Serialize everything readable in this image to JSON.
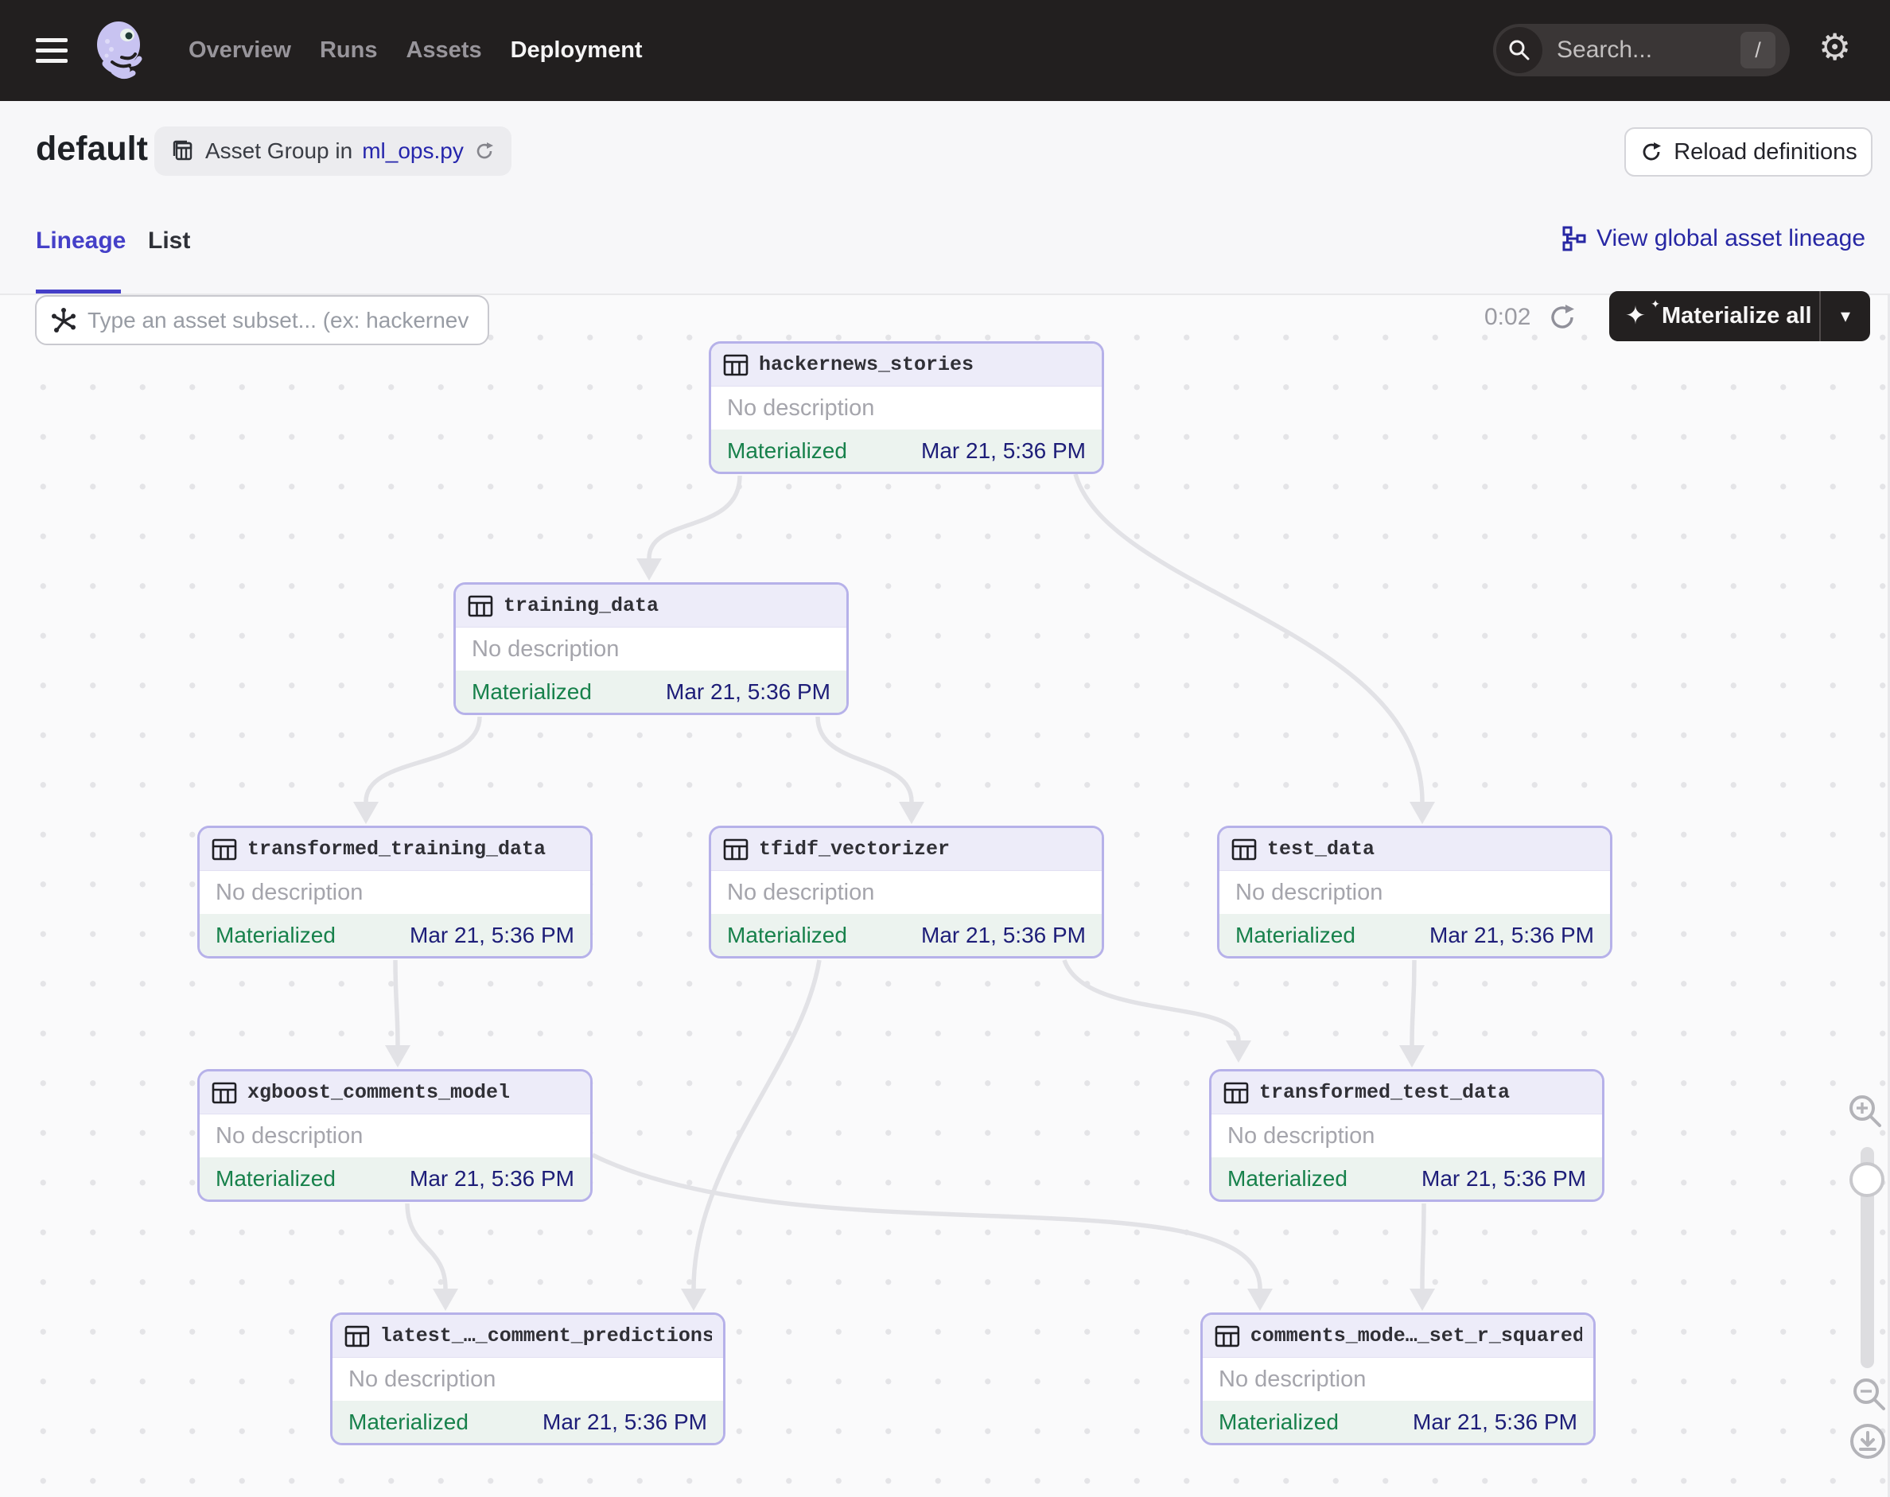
{
  "nav": {
    "items": [
      {
        "label": "Overview",
        "active": false
      },
      {
        "label": "Runs",
        "active": false
      },
      {
        "label": "Assets",
        "active": false
      },
      {
        "label": "Deployment",
        "active": true
      }
    ],
    "search": {
      "placeholder": "Search...",
      "shortcut": "/"
    }
  },
  "header": {
    "title": "default",
    "badge": {
      "prefix": "Asset Group in",
      "link": "ml_ops.py"
    },
    "reload_label": "Reload definitions"
  },
  "tabs": {
    "lineage": "Lineage",
    "list": "List",
    "active": "Lineage"
  },
  "global_lineage_label": "View global asset lineage",
  "toolbar": {
    "subset_placeholder": "Type an asset subset... (ex: hackernev",
    "timer": "0:02",
    "materialize_label": "Materialize all"
  },
  "graph": {
    "nodes": [
      {
        "id": "hn",
        "name": "hackernews_stories",
        "description": "No description",
        "status": "Materialized",
        "date": "Mar 21, 5:36 PM"
      },
      {
        "id": "tr",
        "name": "training_data",
        "description": "No description",
        "status": "Materialized",
        "date": "Mar 21, 5:36 PM"
      },
      {
        "id": "ttr",
        "name": "transformed_training_data",
        "description": "No description",
        "status": "Materialized",
        "date": "Mar 21, 5:36 PM"
      },
      {
        "id": "tf",
        "name": "tfidf_vectorizer",
        "description": "No description",
        "status": "Materialized",
        "date": "Mar 21, 5:36 PM"
      },
      {
        "id": "te",
        "name": "test_data",
        "description": "No description",
        "status": "Materialized",
        "date": "Mar 21, 5:36 PM"
      },
      {
        "id": "xg",
        "name": "xgboost_comments_model",
        "description": "No description",
        "status": "Materialized",
        "date": "Mar 21, 5:36 PM"
      },
      {
        "id": "tte",
        "name": "transformed_test_data",
        "description": "No description",
        "status": "Materialized",
        "date": "Mar 21, 5:36 PM"
      },
      {
        "id": "lp",
        "name": "latest_…_comment_predictions",
        "description": "No description",
        "status": "Materialized",
        "date": "Mar 21, 5:36 PM"
      },
      {
        "id": "rs",
        "name": "comments_mode…_set_r_squared",
        "description": "No description",
        "status": "Materialized",
        "date": "Mar 21, 5:36 PM"
      }
    ],
    "edges": [
      {
        "from": "hn",
        "to": "tr"
      },
      {
        "from": "hn",
        "to": "te"
      },
      {
        "from": "tr",
        "to": "ttr"
      },
      {
        "from": "tr",
        "to": "tf"
      },
      {
        "from": "ttr",
        "to": "xg"
      },
      {
        "from": "tf",
        "to": "lp"
      },
      {
        "from": "tf",
        "to": "tte"
      },
      {
        "from": "te",
        "to": "tte"
      },
      {
        "from": "xg",
        "to": "lp"
      },
      {
        "from": "xg",
        "to": "rs"
      },
      {
        "from": "tte",
        "to": "rs"
      }
    ]
  },
  "colors": {
    "accent_indigo": "#4540C8",
    "link_blue": "#2525AC",
    "status_green": "#17814B",
    "date_navy": "#1D1D78",
    "node_border": "#B6B1E9",
    "nav_dark": "#221F1F",
    "edge_gray": "#E2E2E6"
  }
}
